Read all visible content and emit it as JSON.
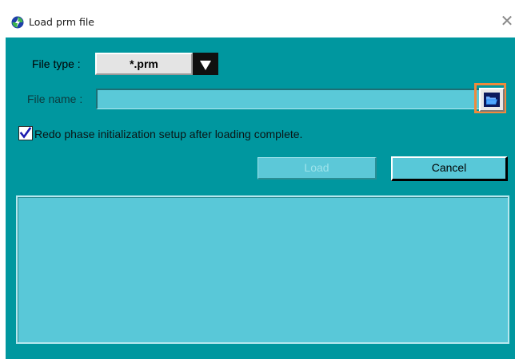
{
  "window": {
    "title": "Load prm file",
    "icon": "app-icon",
    "close_icon": "close-icon",
    "close_glyph": "✕"
  },
  "form": {
    "file_type_label": "File type :",
    "file_type_value": "*.prm",
    "file_name_label": "File name :",
    "file_name_value": "",
    "browse_icon": "folder-open-icon",
    "redo_checkbox_checked": true,
    "redo_checkbox_label": "Redo phase initialization setup after loading complete."
  },
  "actions": {
    "load_label": "Load",
    "load_enabled": false,
    "cancel_label": "Cancel"
  },
  "log": {
    "content": ""
  },
  "colors": {
    "background": "#00979f",
    "field": "#5ac9d8",
    "highlight": "#f08a3c"
  }
}
